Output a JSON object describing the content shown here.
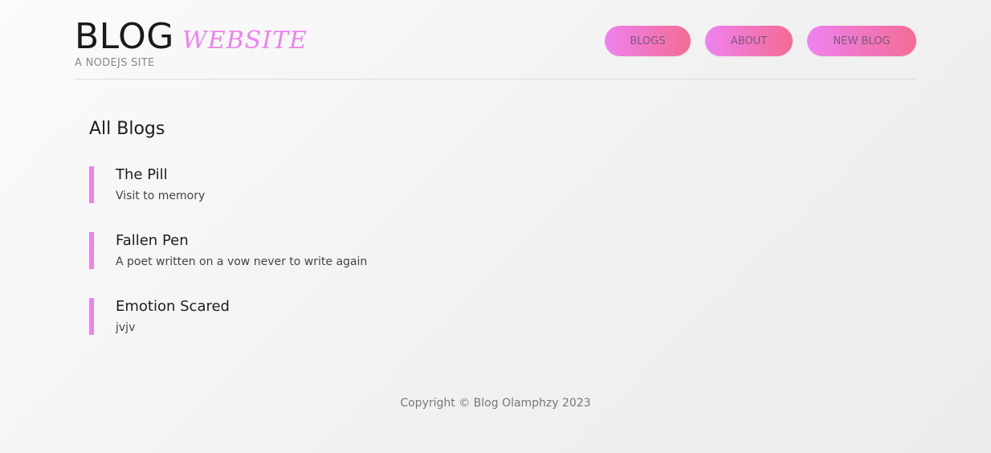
{
  "header": {
    "brand_main": "BLOG",
    "brand_accent": "WEBSITE",
    "tagline": "A NODEJS SITE",
    "nav": [
      {
        "label": "BLOGS"
      },
      {
        "label": "ABOUT"
      },
      {
        "label": "NEW BLOG"
      }
    ]
  },
  "main": {
    "title": "All Blogs",
    "blogs": [
      {
        "title": "The Pill",
        "snippet": "Visit to memory"
      },
      {
        "title": "Fallen Pen",
        "snippet": "A poet written on a vow never to write again"
      },
      {
        "title": "Emotion Scared",
        "snippet": "jvjv"
      }
    ]
  },
  "footer": {
    "copyright": "Copyright © Blog Olamphzy 2023"
  },
  "colors": {
    "accent": "#ee82ee",
    "accent_end": "#f46b96"
  }
}
